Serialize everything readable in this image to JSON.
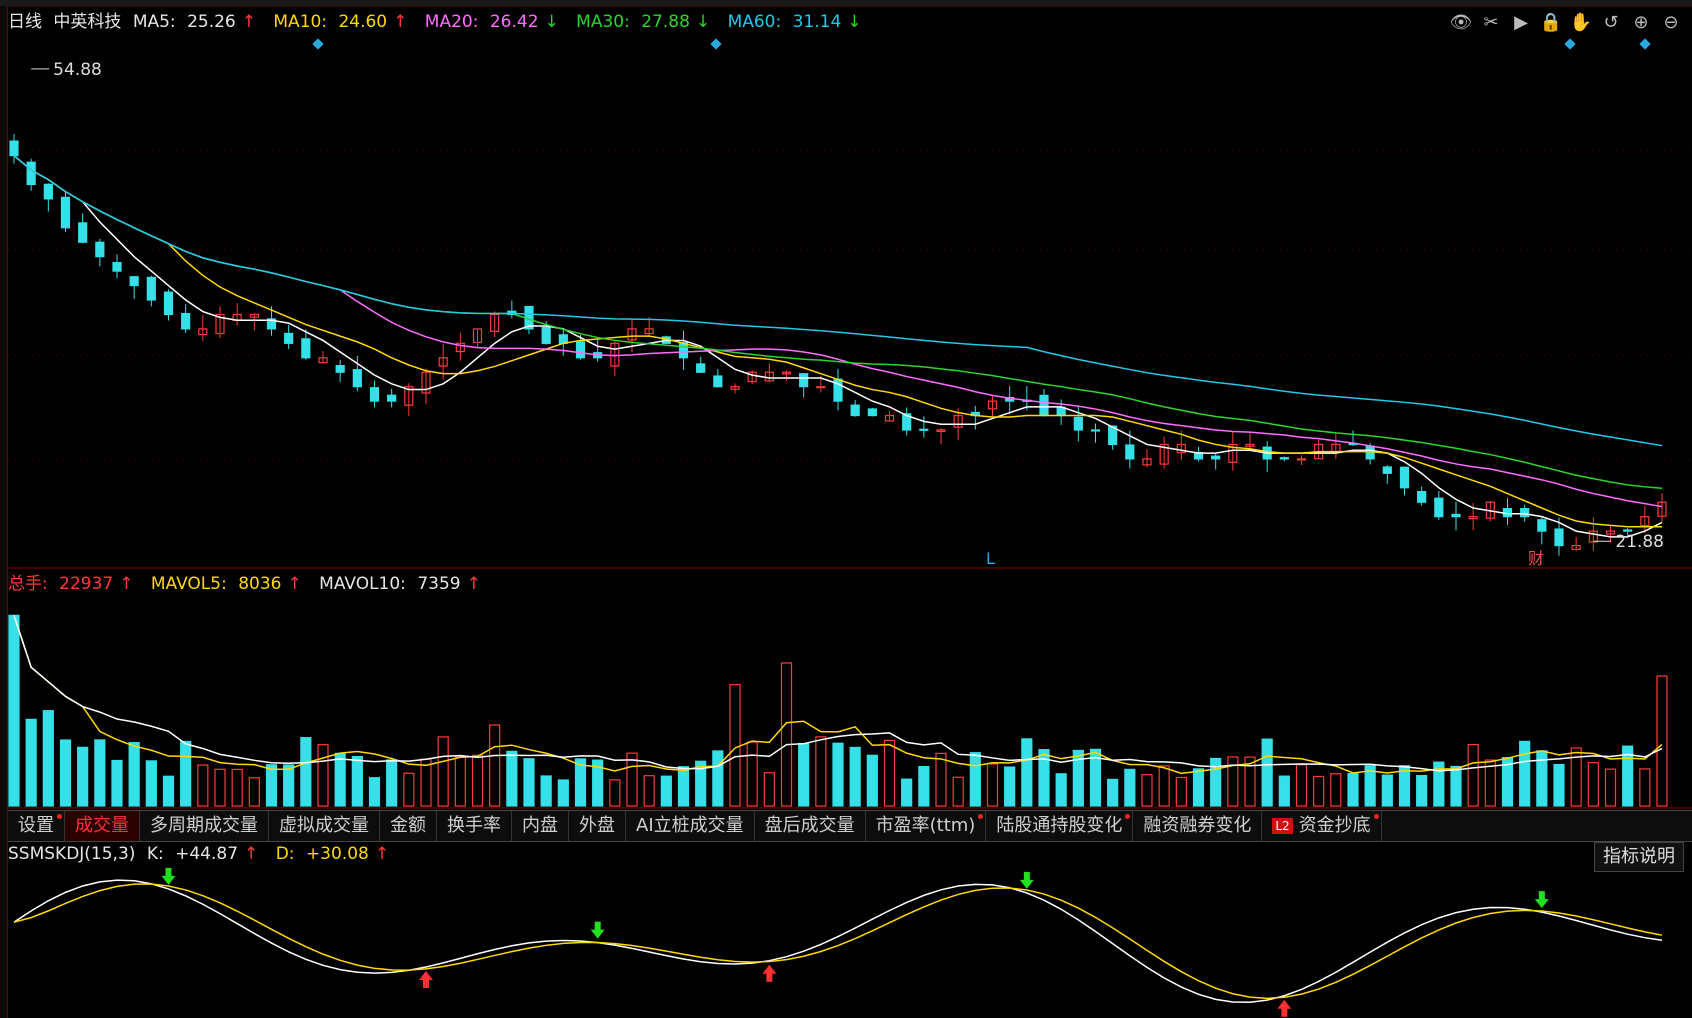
{
  "stock_name": "中英科技",
  "period_label": "日线",
  "ma": {
    "ma5": {
      "label": "MA5:",
      "value": "25.26",
      "arrow": "↑"
    },
    "ma10": {
      "label": "MA10:",
      "value": "24.60",
      "arrow": "↑"
    },
    "ma20": {
      "label": "MA20:",
      "value": "26.42",
      "arrow": "↓"
    },
    "ma30": {
      "label": "MA30:",
      "value": "27.88",
      "arrow": "↓"
    },
    "ma60": {
      "label": "MA60:",
      "value": "31.14",
      "arrow": "↓"
    }
  },
  "price_high_label": "54.88",
  "price_low_label": "21.88",
  "marker_L": "L",
  "marker_cai": "财",
  "volume": {
    "total": {
      "label": "总手:",
      "value": "22937",
      "arrow": "↑"
    },
    "mavol5": {
      "label": "MAVOL5:",
      "value": "8036",
      "arrow": "↑"
    },
    "mavol10": {
      "label": "MAVOL10:",
      "value": "7359",
      "arrow": "↑"
    }
  },
  "tabs": [
    {
      "label": "设置",
      "active": false,
      "dot": true
    },
    {
      "label": "成交量",
      "active": true,
      "dot": false
    },
    {
      "label": "多周期成交量",
      "active": false,
      "dot": false
    },
    {
      "label": "虚拟成交量",
      "active": false,
      "dot": false
    },
    {
      "label": "金额",
      "active": false,
      "dot": false
    },
    {
      "label": "换手率",
      "active": false,
      "dot": false
    },
    {
      "label": "内盘",
      "active": false,
      "dot": false
    },
    {
      "label": "外盘",
      "active": false,
      "dot": false
    },
    {
      "label": "AI立桩成交量",
      "active": false,
      "dot": false
    },
    {
      "label": "盘后成交量",
      "active": false,
      "dot": false
    },
    {
      "label": "市盈率(ttm)",
      "active": false,
      "dot": true
    },
    {
      "label": "陆股通持股变化",
      "active": false,
      "dot": true
    },
    {
      "label": "融资融券变化",
      "active": false,
      "dot": false
    },
    {
      "label": "资金抄底",
      "active": false,
      "dot": true,
      "badge": "L2"
    }
  ],
  "kdj": {
    "name": "SSMSKDJ(15,3)",
    "k_label": "K:",
    "k_value": "+44.87",
    "k_arrow": "↑",
    "d_label": "D:",
    "d_value": "+30.08",
    "d_arrow": "↑"
  },
  "explain_button": "指标说明",
  "colors": {
    "up": "#ff3a3a",
    "down": "#35e0e8",
    "ma5": "#ffffff",
    "ma10": "#ffd800",
    "ma20": "#ff6cff",
    "ma30": "#2bd62b",
    "ma60": "#22c8e8"
  },
  "toolbar_icons": [
    "eye-icon",
    "scissors-icon",
    "play-icon",
    "lock-icon",
    "hand-icon",
    "undo-icon",
    "zoom-in-icon",
    "zoom-out-icon"
  ],
  "chart_data": {
    "type": "candlestick",
    "title": "",
    "price_range": [
      21.0,
      57.0
    ],
    "close_series": [
      49,
      47,
      46,
      44,
      43,
      42,
      41,
      40,
      39,
      38,
      37,
      37,
      38,
      38,
      38,
      37,
      36,
      35,
      35,
      34,
      33,
      32,
      32,
      33,
      34,
      35,
      36,
      37,
      38,
      38,
      37,
      36,
      36,
      35,
      35,
      36,
      37,
      37,
      36,
      35,
      34,
      33,
      33,
      34,
      34,
      34,
      33,
      33,
      32,
      31,
      31,
      31,
      30,
      30,
      30,
      31,
      31,
      32,
      32,
      32,
      31,
      31,
      30,
      30,
      29,
      28,
      28,
      29,
      29,
      28,
      28,
      29,
      29,
      28,
      28,
      28,
      29,
      29,
      29,
      28,
      27,
      26,
      25,
      24,
      24,
      24,
      25,
      24,
      24,
      23,
      22,
      22,
      23,
      23,
      23,
      24,
      25
    ],
    "volume_range": [
      0,
      24000
    ],
    "kdj_range": [
      0,
      100
    ]
  }
}
